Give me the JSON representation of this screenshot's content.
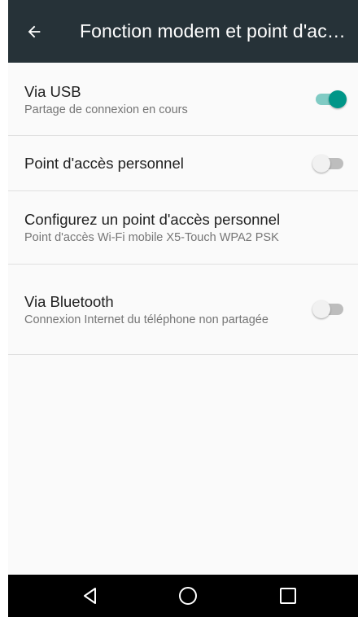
{
  "app_bar": {
    "title": "Fonction modem et point d'ac…",
    "back_icon": "arrow-left-icon"
  },
  "settings": [
    {
      "title": "Via USB",
      "subtitle": "Partage de connexion en cours",
      "toggle": true
    },
    {
      "title": "Point d'accès personnel",
      "toggle": false
    },
    {
      "title": "Configurez un point d'accès personnel",
      "subtitle": "Point d'accès Wi-Fi mobile X5-Touch WPA2 PSK"
    },
    {
      "title": "Via Bluetooth",
      "subtitle": "Connexion Internet du téléphone non partagée",
      "toggle": false
    }
  ],
  "nav_bar": {
    "back_icon": "triangle-back-icon",
    "home_icon": "circle-home-icon",
    "recents_icon": "square-recents-icon"
  },
  "colors": {
    "app_bar": "#263238",
    "accent": "#009688",
    "accent_track": "#80cbc4"
  }
}
